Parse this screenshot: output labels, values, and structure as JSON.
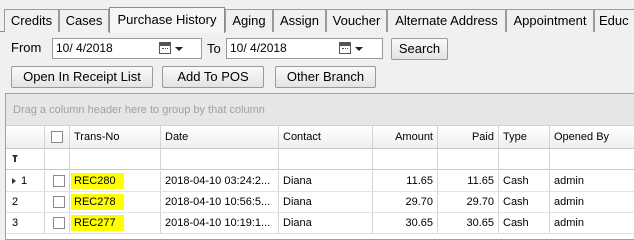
{
  "tabs": [
    {
      "label": "Credits",
      "active": false
    },
    {
      "label": "Cases",
      "active": false
    },
    {
      "label": "Purchase History",
      "active": true
    },
    {
      "label": "Aging",
      "active": false
    },
    {
      "label": "Assign",
      "active": false
    },
    {
      "label": "Voucher",
      "active": false
    },
    {
      "label": "Alternate Address",
      "active": false
    },
    {
      "label": "Appointment",
      "active": false
    },
    {
      "label": "Educ",
      "active": false
    }
  ],
  "filter": {
    "from_label": "From",
    "from_value": "10/ 4/2018",
    "to_label": "To",
    "to_value": "10/ 4/2018",
    "search_label": "Search"
  },
  "actions": {
    "open_receipt_list": "Open In Receipt List",
    "add_to_pos": "Add To POS",
    "other_branch": "Other Branch"
  },
  "grid": {
    "group_hint": "Drag a column header here to group by that column",
    "columns": [
      "Trans-No",
      "Date",
      "Contact",
      "Amount",
      "Paid",
      "Type",
      "Opened By"
    ],
    "rows": [
      {
        "num": "1",
        "trans_no": "REC280",
        "date": "2018-04-10 03:24:2...",
        "contact": "Diana",
        "amount": "11.65",
        "paid": "11.65",
        "type": "Cash",
        "opened_by": "admin",
        "current": true
      },
      {
        "num": "2",
        "trans_no": "REC278",
        "date": "2018-04-10 10:56:5...",
        "contact": "Diana",
        "amount": "29.70",
        "paid": "29.70",
        "type": "Cash",
        "opened_by": "admin",
        "current": false
      },
      {
        "num": "3",
        "trans_no": "REC277",
        "date": "2018-04-10 10:19:1...",
        "contact": "Diana",
        "amount": "30.65",
        "paid": "30.65",
        "type": "Cash",
        "opened_by": "admin",
        "current": false
      }
    ]
  },
  "colors": {
    "highlight": "#ffff00",
    "window_bg": "#f0f0f0",
    "group_panel_bg": "#e6e6e6"
  }
}
